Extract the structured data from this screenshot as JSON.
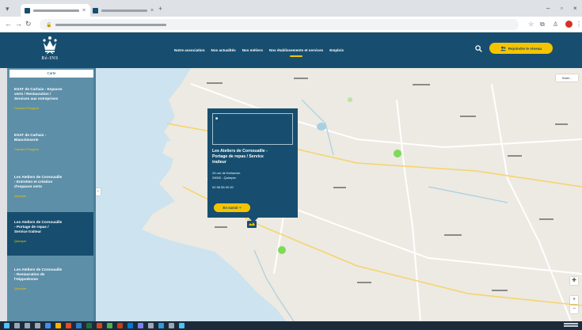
{
  "colors": {
    "brand_navy": "#174e6f",
    "brand_yellow": "#f5c400",
    "sidebar_blue": "#5d8fa8",
    "map_marker_green": "#7ed957"
  },
  "header": {
    "logo_text": "Ré-INS",
    "nav_items": [
      {
        "label": "Notre association"
      },
      {
        "label": "Nos actualités"
      },
      {
        "label": "Nos métiers"
      },
      {
        "label": "Nos établissements et services"
      },
      {
        "label": "Emplois"
      }
    ],
    "search_icon": "search-icon",
    "cta_label": "Rejoindre le réseau"
  },
  "sidebar": {
    "tab_label": "Carte",
    "items": [
      {
        "title": "ESAT de Carhaix - Espaces\nverts / Restauration /\nServices aux entreprises",
        "subtitle": "Carhaix-Plouguer"
      },
      {
        "title": "ESAT de Carhaix -\nBlanchisserie",
        "subtitle": "Carhaix-Plouguer"
      },
      {
        "title": "Les Ateliers de Cornouaille\n- Entretien et création\nd'espaces verts",
        "subtitle": "Quimper"
      },
      {
        "title": "Les Ateliers de Cornouaille\n- Portage de repas /\nService traiteur",
        "subtitle": "Quimper"
      },
      {
        "title": "Les Ateliers de Cornouaille\n- Restauration de\nl'Hippodrome",
        "subtitle": "Quimper"
      }
    ]
  },
  "popup": {
    "title": "Les Ateliers de Cornouaille -\nPortage de repas / Service\ntraiteur",
    "address": "24 rue de Kerlaeron\n29000 - Quimper",
    "phone": "02 98 55 00 00",
    "button_label": "En savoir +"
  },
  "map": {
    "map_type_label": "Satel..."
  }
}
